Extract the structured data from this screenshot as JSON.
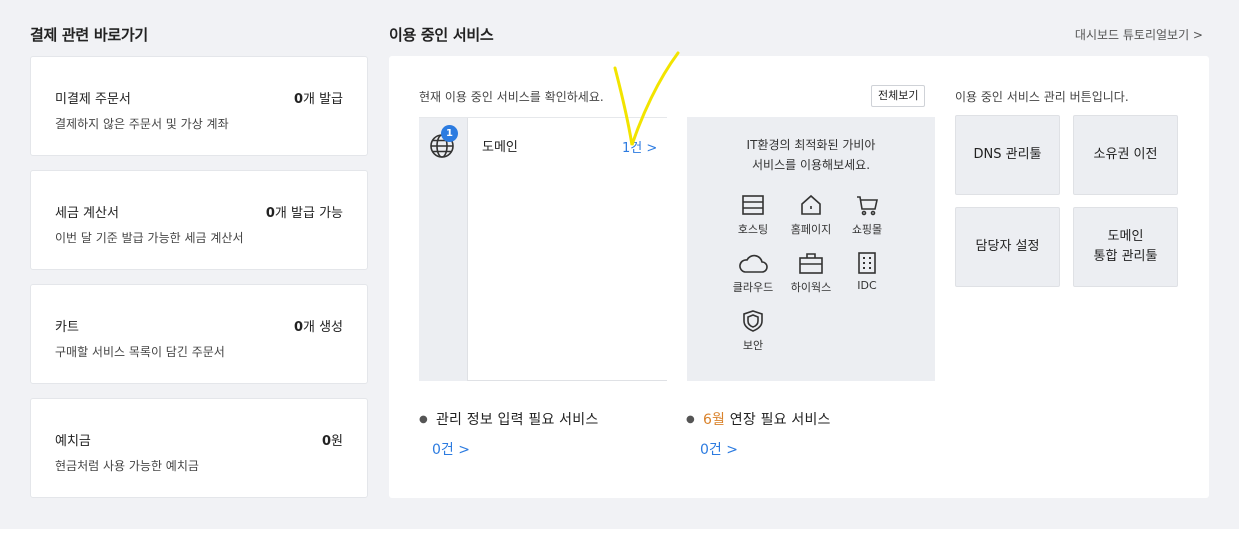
{
  "billing": {
    "title": "결제 관련 바로가기",
    "cards": [
      {
        "title": "미결제 주문서",
        "count": "0",
        "unit": "개 발급",
        "desc": "결제하지 않은 주문서 및 가상 계좌"
      },
      {
        "title": "세금 계산서",
        "count": "0",
        "unit": "개 발급 가능",
        "desc": "이번 달 기준 발급 가능한 세금 계산서"
      },
      {
        "title": "카트",
        "count": "0",
        "unit": "개 생성",
        "desc": "구매할 서비스 목록이 담긴 주문서"
      },
      {
        "title": "예치금",
        "count": "0",
        "unit": "원",
        "desc": "현금처럼 사용 가능한 예치금"
      }
    ]
  },
  "services": {
    "title": "이용 중인 서비스",
    "tutorial_link": "대시보드 튜토리얼보기 >",
    "desc": "현재 이용 중인 서비스를 확인하세요.",
    "view_all": "전체보기",
    "domain": {
      "badge": "1",
      "icon": "globe-icon",
      "name": "도메인",
      "count": "1건 >"
    },
    "promo": {
      "line1": "IT환경의 최적화된 가비아",
      "line2": "서비스를 이용해보세요.",
      "items": [
        {
          "icon": "server-icon",
          "label": "호스팅"
        },
        {
          "icon": "home-icon",
          "label": "홈페이지"
        },
        {
          "icon": "cart-icon",
          "label": "쇼핑몰"
        },
        {
          "icon": "cloud-icon",
          "label": "클라우드"
        },
        {
          "icon": "briefcase-icon",
          "label": "하이웍스"
        },
        {
          "icon": "building-icon",
          "label": "IDC"
        },
        {
          "icon": "shield-icon",
          "label": "보안"
        }
      ]
    },
    "management": {
      "desc": "이용 중인 서비스 관리 버튼입니다.",
      "buttons": [
        "DNS 관리툴",
        "소유권 이전",
        "담당자 설정",
        "도메인\n통합 관리툴"
      ]
    },
    "needs_info": {
      "label": "관리 정보 입력 필요 서비스",
      "count": "0건 >"
    },
    "renewal": {
      "month": "6월",
      "label": " 연장 필요 서비스",
      "count": "0건 >"
    }
  },
  "colors": {
    "accent_blue": "#2c7be0",
    "highlight_orange": "#d9822b",
    "annotation_yellow": "#f2e400"
  }
}
